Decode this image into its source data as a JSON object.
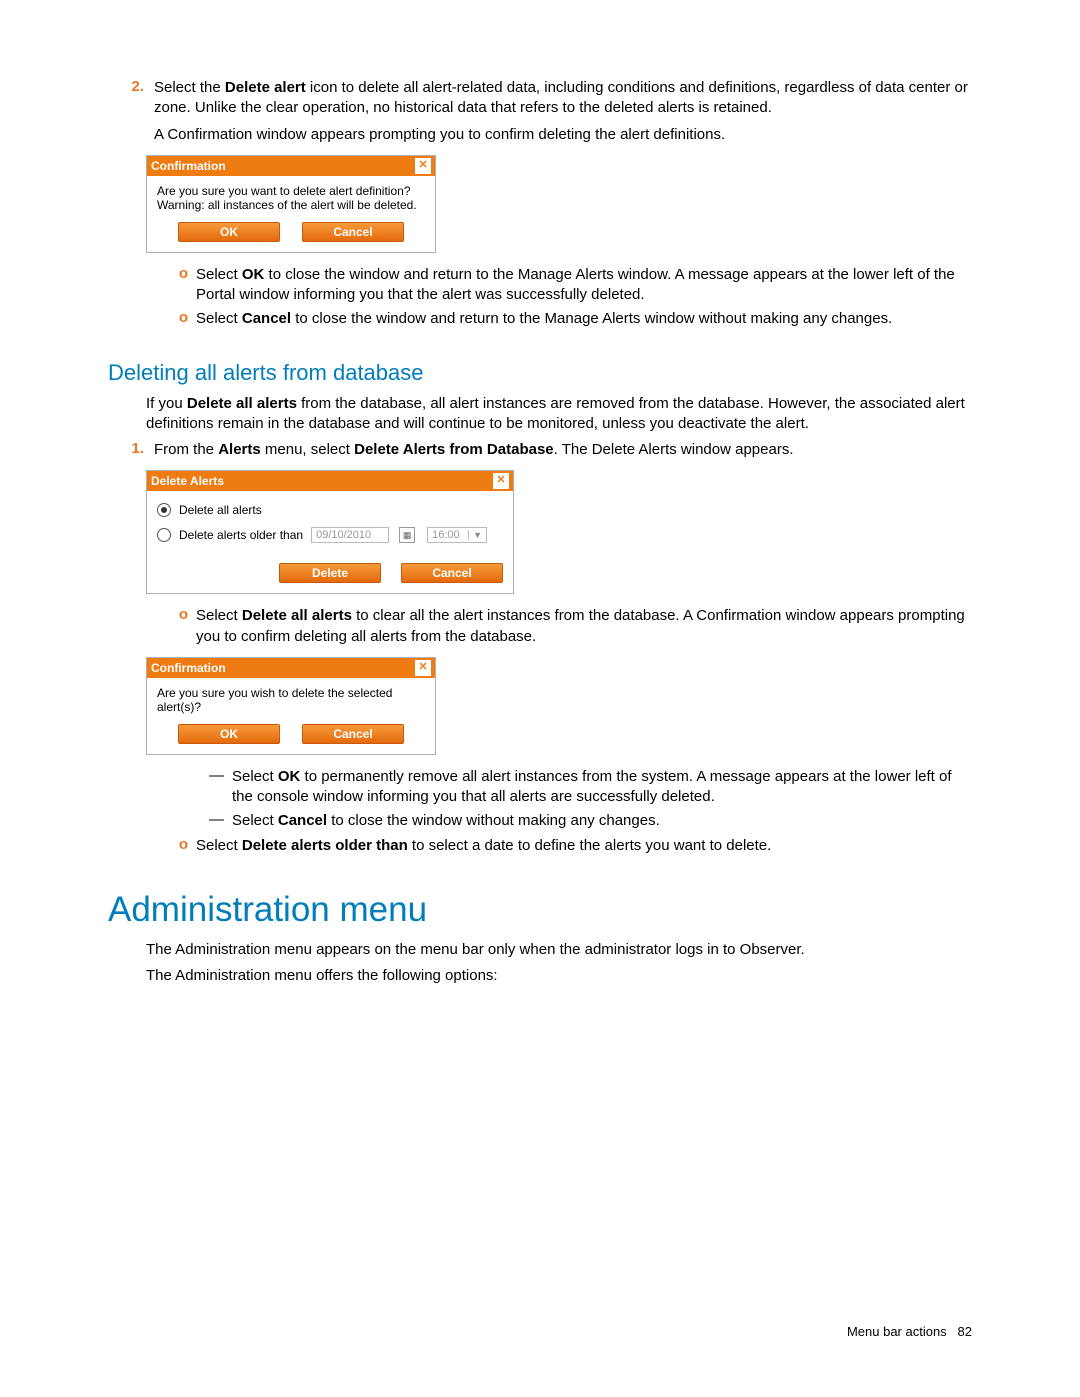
{
  "step2": {
    "num": "2.",
    "text_pre": "Select the ",
    "text_bold": "Delete alert",
    "text_post": " icon to delete all alert-related data, including conditions and definitions, regardless of data center or zone. Unlike the clear operation, no historical data that refers to the deleted alerts is retained.",
    "line2": "A Confirmation window appears prompting you to confirm deleting the alert definitions."
  },
  "dialog1": {
    "title": "Confirmation",
    "body": "Are you sure you want to delete alert definition? Warning: all instances of the alert will be deleted.",
    "ok": "OK",
    "cancel": "Cancel"
  },
  "sub1a": {
    "bullet": "o",
    "pre": "Select ",
    "bold": "OK",
    "post": " to close the window and return to the Manage Alerts window. A message appears at the lower left of the Portal window informing you that the alert was successfully deleted."
  },
  "sub1b": {
    "bullet": "o",
    "pre": "Select ",
    "bold": "Cancel",
    "post": " to close the window and return to the Manage Alerts window without making any changes."
  },
  "subhead": "Deleting all alerts from database",
  "subpara_pre": "If you ",
  "subpara_bold": "Delete all alerts",
  "subpara_post": " from the database, all alert instances are removed from the database. However, the associated alert definitions remain in the database and will continue to be monitored, unless you deactivate the alert.",
  "step1b": {
    "num": "1.",
    "pre": "From the ",
    "b1": "Alerts",
    "mid": " menu, select ",
    "b2": "Delete Alerts from Database",
    "post": ". The Delete Alerts window appears."
  },
  "dialog2": {
    "title": "Delete Alerts",
    "opt1": "Delete all alerts",
    "opt2": "Delete alerts older than",
    "date": "09/10/2010",
    "time": "16:00",
    "delete": "Delete",
    "cancel": "Cancel"
  },
  "sub2a": {
    "bullet": "o",
    "pre": "Select ",
    "bold": "Delete all alerts",
    "post": " to clear all the alert instances from the database. A Confirmation window appears prompting you to confirm deleting all alerts from the database."
  },
  "dialog3": {
    "title": "Confirmation",
    "body": "Are you sure you wish to delete the selected alert(s)?",
    "ok": "OK",
    "cancel": "Cancel"
  },
  "dash1": {
    "dash": "—",
    "pre": "Select ",
    "bold": "OK",
    "post": " to permanently remove all alert instances from the system. A message appears at the lower left of the console window informing you that all alerts are successfully deleted."
  },
  "dash2": {
    "dash": "—",
    "pre": "Select ",
    "bold": "Cancel",
    "post": " to close the window without making any changes."
  },
  "sub2b": {
    "bullet": "o",
    "pre": "Select ",
    "bold": "Delete alerts older than",
    "post": " to select a date to define the alerts you want to delete."
  },
  "h1": "Administration menu",
  "adminpara1": "The Administration menu appears on the menu bar only when the administrator logs in to Observer.",
  "adminpara2": "The Administration menu offers the following options:",
  "footer_label": "Menu bar actions",
  "footer_page": "82"
}
